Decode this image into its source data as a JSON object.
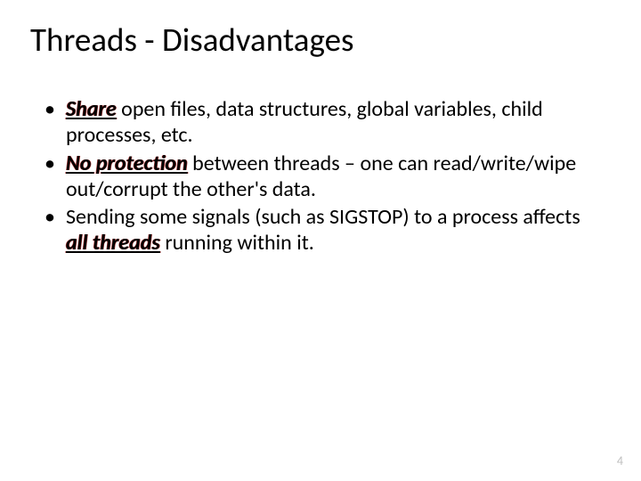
{
  "title": "Threads - Disadvantages",
  "bullets": [
    {
      "emph": "Share",
      "rest": " open files, data structures, global variables, child processes, etc."
    },
    {
      "emph": "No protection",
      "rest": " between threads – one can read/write/wipe out/corrupt the other's data."
    },
    {
      "pre": "Sending some signals (such as SIGSTOP) to a process affects ",
      "emph": "all threads",
      "rest": " running within it."
    }
  ],
  "pageNumber": "4"
}
